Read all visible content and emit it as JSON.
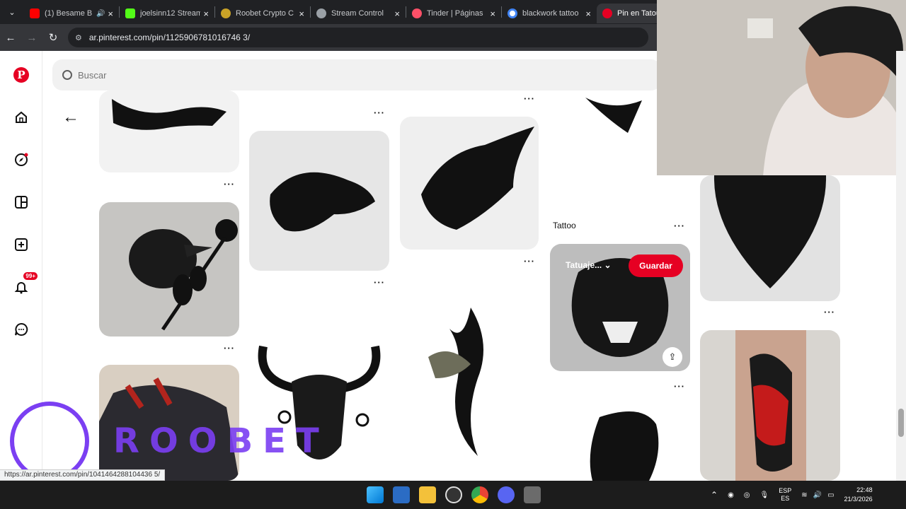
{
  "browser": {
    "tabs": [
      {
        "label": "(1) Besame B",
        "favicon_color": "#ff0000",
        "icon": "youtube-icon",
        "audio": true
      },
      {
        "label": "joelsinn12 Stream",
        "favicon_color": "#53fc18",
        "icon": "kick-icon"
      },
      {
        "label": "Roobet Crypto C",
        "favicon_color": "#c9a227",
        "icon": "roobet-icon"
      },
      {
        "label": "Stream Control",
        "favicon_color": "#9aa0a6",
        "icon": "globe-icon"
      },
      {
        "label": "Tinder | Páginas",
        "favicon_color": "#fd5068",
        "icon": "tinder-icon"
      },
      {
        "label": "blackwork tattoo",
        "favicon_color": "#4285f4",
        "icon": "google-icon"
      },
      {
        "label": "Pin en Tatouage",
        "favicon_color": "#e60023",
        "icon": "pinterest-icon",
        "active": true
      }
    ],
    "url": "ar.pinterest.com/pin/1125906781016746 3/",
    "status_url": "https://ar.pinterest.com/pin/1041464288104436 5/"
  },
  "search": {
    "placeholder": "Buscar"
  },
  "sidebar": {
    "items": [
      {
        "name": "pinterest-logo"
      },
      {
        "name": "home-icon"
      },
      {
        "name": "explore-icon"
      },
      {
        "name": "boards-icon"
      },
      {
        "name": "create-icon"
      },
      {
        "name": "notifications-icon",
        "badge": "99+"
      },
      {
        "name": "messages-icon"
      }
    ]
  },
  "pins": {
    "tattoo_label": "Tattoo",
    "hover": {
      "board": "Tatuaje...",
      "save": "Guardar"
    },
    "more": "···"
  },
  "overlay": {
    "roobet_text": "ROOBET"
  },
  "taskbar": {
    "lang_top": "ESP",
    "lang_bottom": "ES",
    "time": "22:48",
    "date": "21/3/2026"
  },
  "colors": {
    "pinterest_red": "#e60023",
    "roobet_purple": "#7b3ff2"
  }
}
